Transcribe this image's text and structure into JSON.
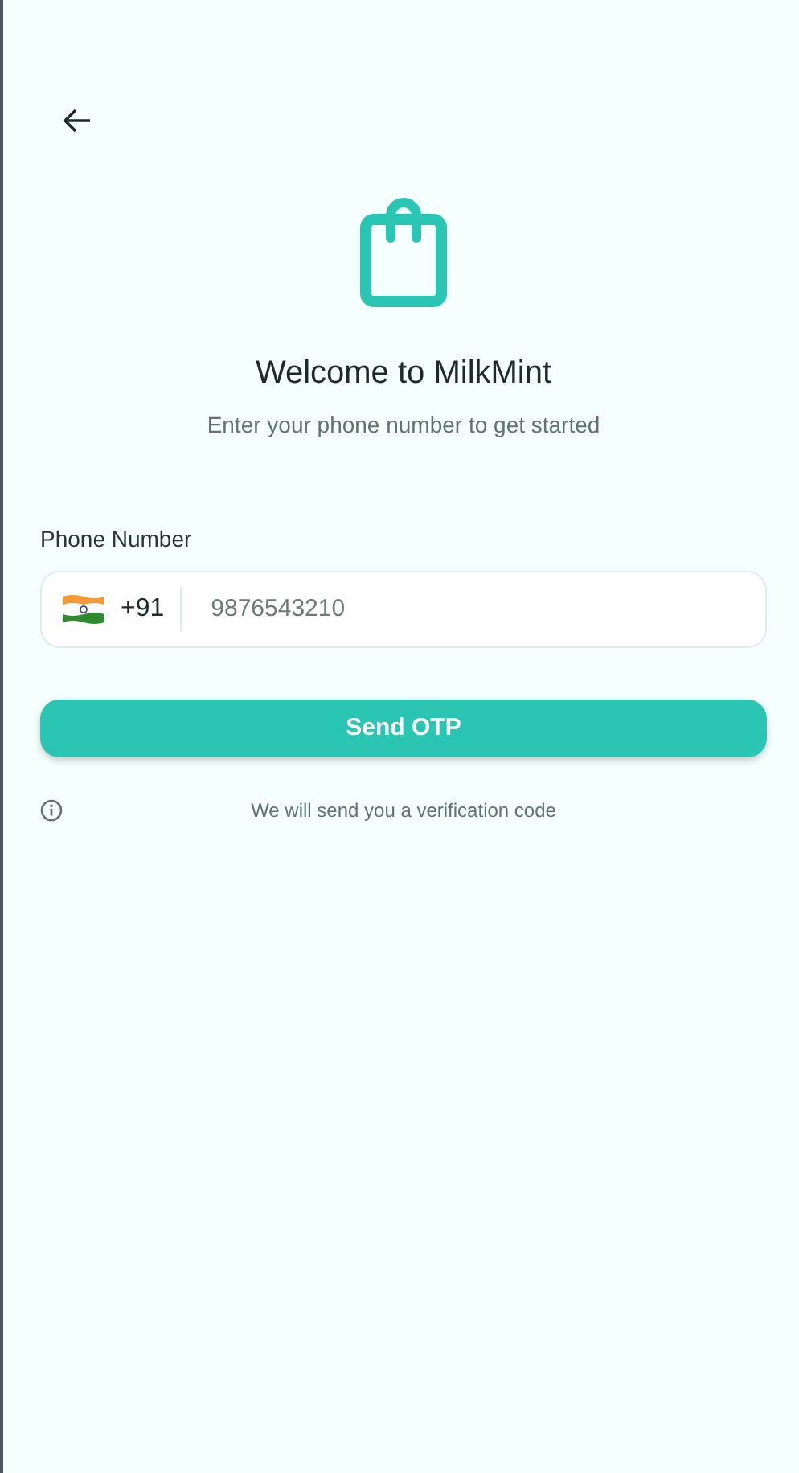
{
  "header": {
    "title": "Welcome to MilkMint",
    "subtitle": "Enter your phone number to get started"
  },
  "phone": {
    "label": "Phone Number",
    "country_code": "+91",
    "placeholder": "9876543210"
  },
  "button": {
    "label": "Send OTP"
  },
  "note": {
    "text": "We will send you a verification code"
  }
}
